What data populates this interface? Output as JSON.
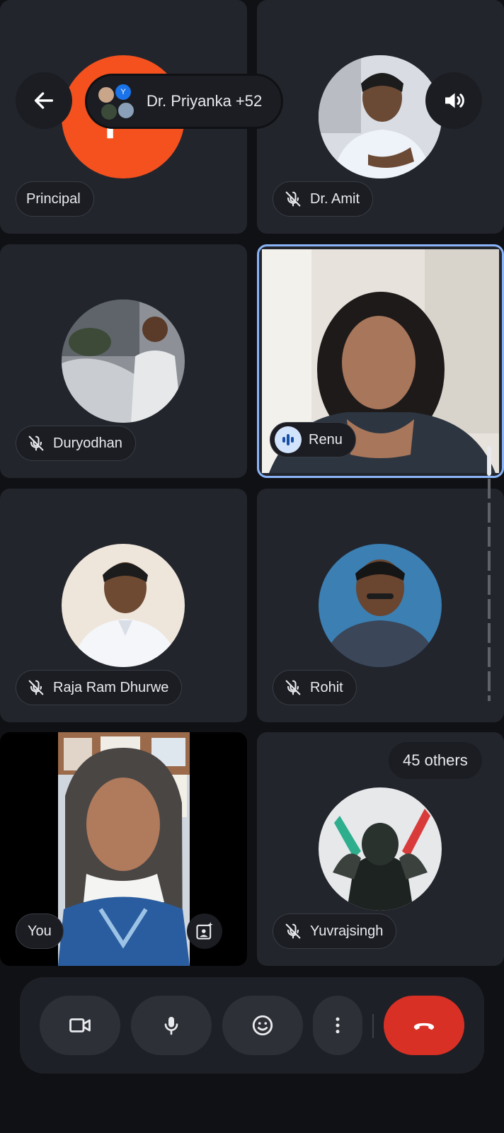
{
  "header": {
    "back_icon": "arrow-left-icon",
    "meeting_title": "Dr. Priyanka +52",
    "speaker_icon": "speaker-icon",
    "mini_avatar_initial": "Y"
  },
  "participants": [
    {
      "name": "Principal",
      "muted": false,
      "initial": "P"
    },
    {
      "name": "Dr. Amit",
      "muted": true
    },
    {
      "name": "Duryodhan",
      "muted": true
    },
    {
      "name": "Renu",
      "muted": false,
      "speaking": true
    },
    {
      "name": "Raja Ram Dhurwe",
      "muted": true
    },
    {
      "name": "Rohit",
      "muted": true
    },
    {
      "name": "You",
      "muted": false
    },
    {
      "name": "Yuvrajsingh",
      "muted": true
    }
  ],
  "others_badge": "45 others",
  "controls": {
    "camera_icon": "video-camera-icon",
    "mic_icon": "microphone-icon",
    "reactions_icon": "emoji-icon",
    "more_icon": "more-vertical-icon",
    "end_call_icon": "end-call-icon",
    "end_call_color": "#d93025"
  },
  "colors": {
    "background": "#101114",
    "tile": "#23252d",
    "principal_avatar": "#f4511e",
    "active_speaker_border": "#8ab4f8"
  }
}
